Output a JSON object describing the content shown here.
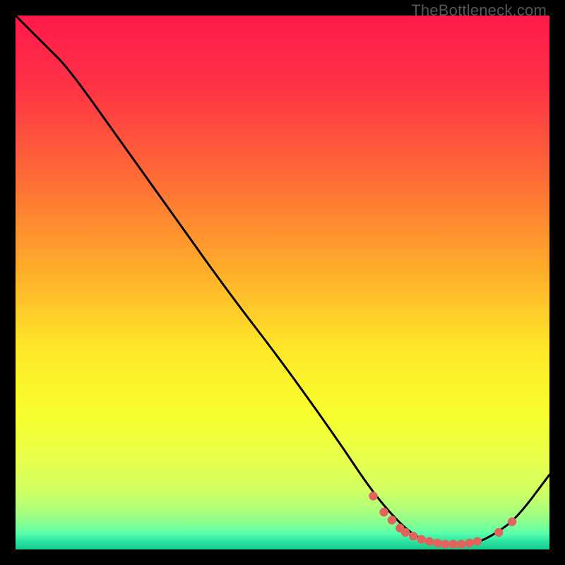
{
  "watermark": "TheBottleneck.com",
  "chart_data": {
    "type": "line",
    "title": "",
    "xlabel": "",
    "ylabel": "",
    "xlim": [
      0,
      100
    ],
    "ylim": [
      0,
      100
    ],
    "note": "Axes are unlabeled in the source image; x and y are normalized 0–100. Curve value = visual height above bottom of plot area (0 = bottom, 100 = top).",
    "series": [
      {
        "name": "curve",
        "x": [
          0,
          6,
          10,
          20,
          30,
          40,
          50,
          60,
          66,
          70,
          74,
          78,
          82,
          86,
          90,
          94,
          100
        ],
        "y": [
          100,
          94,
          90,
          76,
          62,
          48,
          35,
          21,
          12,
          7,
          3,
          1,
          1,
          1,
          3,
          6,
          14
        ]
      }
    ],
    "markers": {
      "name": "highlight-dots",
      "x": [
        67,
        69,
        70.5,
        72,
        73,
        74.5,
        76,
        77.5,
        79,
        80.5,
        82,
        83.5,
        85,
        86.5,
        90.5,
        93
      ],
      "y": [
        10,
        7,
        5.5,
        4,
        3.2,
        2.5,
        1.9,
        1.5,
        1.2,
        1.0,
        1.0,
        1.0,
        1.2,
        1.5,
        3.2,
        5.2
      ]
    },
    "gradient_stops": [
      {
        "offset": 0.0,
        "color": "#ff1a4b"
      },
      {
        "offset": 0.12,
        "color": "#ff2f46"
      },
      {
        "offset": 0.3,
        "color": "#ff6a36"
      },
      {
        "offset": 0.48,
        "color": "#ffae2a"
      },
      {
        "offset": 0.62,
        "color": "#ffe629"
      },
      {
        "offset": 0.75,
        "color": "#f7ff2e"
      },
      {
        "offset": 0.83,
        "color": "#e7ff4a"
      },
      {
        "offset": 0.885,
        "color": "#d4ff60"
      },
      {
        "offset": 0.915,
        "color": "#b8ff73"
      },
      {
        "offset": 0.938,
        "color": "#9cff85"
      },
      {
        "offset": 0.955,
        "color": "#7dff97"
      },
      {
        "offset": 0.97,
        "color": "#5affaa"
      },
      {
        "offset": 0.983,
        "color": "#30e7a4"
      },
      {
        "offset": 1.0,
        "color": "#14c98e"
      }
    ],
    "curve_color": "#000000",
    "marker_color": "#e0645c"
  }
}
